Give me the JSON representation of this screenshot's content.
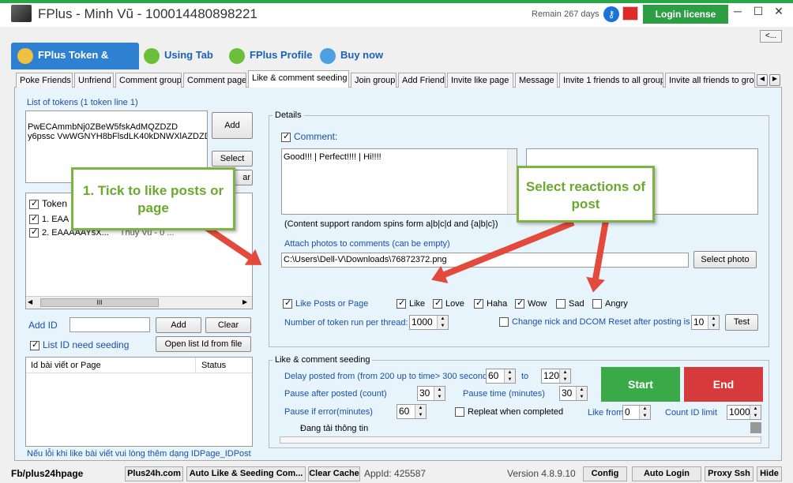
{
  "window": {
    "title": "FPlus - Minh Vũ - 100014480898221",
    "remain": "Remain 267 days",
    "login_label": "Login license"
  },
  "collapse_button": "<...",
  "main_tabs": [
    {
      "label": "FPlus Token & Cookie"
    },
    {
      "label": "Using Tab"
    },
    {
      "label": "FPlus Profile"
    },
    {
      "label": "Buy now"
    }
  ],
  "sub_tabs": [
    "Poke Friends",
    "Unfriend",
    "Comment group",
    "Comment page",
    "Like & comment seeding",
    "Join group",
    "Add Friend",
    "Invite like page",
    "Message",
    "Invite 1 friends to all group",
    "Invite all friends to gro"
  ],
  "left": {
    "tokens_label": "List of tokens (1 token line 1)",
    "token_lines": [
      "PwECAmmbNj0ZBeW5fskAdMQZDZD",
      "y6pssc VwWGNYH8bFlsdLK40kDNWXlAZDZD"
    ],
    "add_label": "Add",
    "select_label": "Select",
    "clear_partial": "ar",
    "list_header": "Token",
    "rows": [
      {
        "num": "1. EAA",
        "name": ""
      },
      {
        "num": "2. EAAAAAYsX...",
        "name": "Thuy Vu - 0 ..."
      }
    ],
    "scroll_grip": "III",
    "add_id_label": "Add ID",
    "add_id_value": "",
    "add_button": "Add",
    "clear_button": "Clear",
    "list_id_label": "List ID need seeding",
    "open_list_label": "Open list Id from file",
    "post_col1": "Id bài viết or Page",
    "post_col2": "Status",
    "note": "Nếu lỗi khi like bài viết vui lòng thêm dạng IDPage_IDPost"
  },
  "details": {
    "group_label": "Details",
    "comment_label": "Comment:",
    "comment_text": "Good!!! | Perfect!!!! | Hi!!!!",
    "spin_note": "(Content support random spins form a|b|c|d and {a|b|c})",
    "attach_label": "Attach photos to comments (can be empty)",
    "photo_path": "C:\\Users\\Dell-V\\Downloads\\76872372.png",
    "select_photo_label": "Select photo",
    "like_posts_label": "Like Posts or Page",
    "reactions": [
      "Like",
      "Love",
      "Haha",
      "Wow",
      "Sad",
      "Angry"
    ],
    "threads_label": "Number of token run per thread:",
    "threads_value": "1000",
    "change_nick_label": "Change nick and DCOM Reset after posting is",
    "change_nick_value": "10",
    "test_label": "Test"
  },
  "seeding": {
    "group_label": "Like & comment seeding",
    "delay_label": "Delay posted from (from 200 up to time> 300 seconds)",
    "delay_from": "60",
    "to_label": "to",
    "delay_to": "120",
    "pause_after_label": "Pause after posted (count)",
    "pause_after_value": "30",
    "pause_time_label": "Pause time (minutes)",
    "pause_time_value": "30",
    "pause_error_label": "Pause if error(minutes)",
    "pause_error_value": "60",
    "repeat_label": "Repleat when completed",
    "like_from_label": "Like from",
    "like_from_value": "0",
    "count_limit_label": "Count ID limit",
    "count_limit_value": "1000",
    "status_text": "Đang tải thông tin",
    "start_label": "Start",
    "end_label": "End"
  },
  "callouts": {
    "one": "1. Tick to like posts or page",
    "two": "Select reactions of post"
  },
  "statusbar": {
    "fb": "Fb/plus24hpage",
    "buttons": [
      "Plus24h.com",
      "Auto Like & Seeding Com...",
      "Clear Cache"
    ],
    "appid": "AppId: 425587",
    "version": "Version 4.8.9.10",
    "right_buttons": [
      "Config",
      "Auto Login",
      "Proxy Ssh",
      "Hide"
    ]
  },
  "colors": {
    "accent": "#2e80d0",
    "start": "#3aaa48",
    "end": "#d63a3a",
    "callout_border": "#7cb342",
    "arrow": "#e24a3b"
  }
}
